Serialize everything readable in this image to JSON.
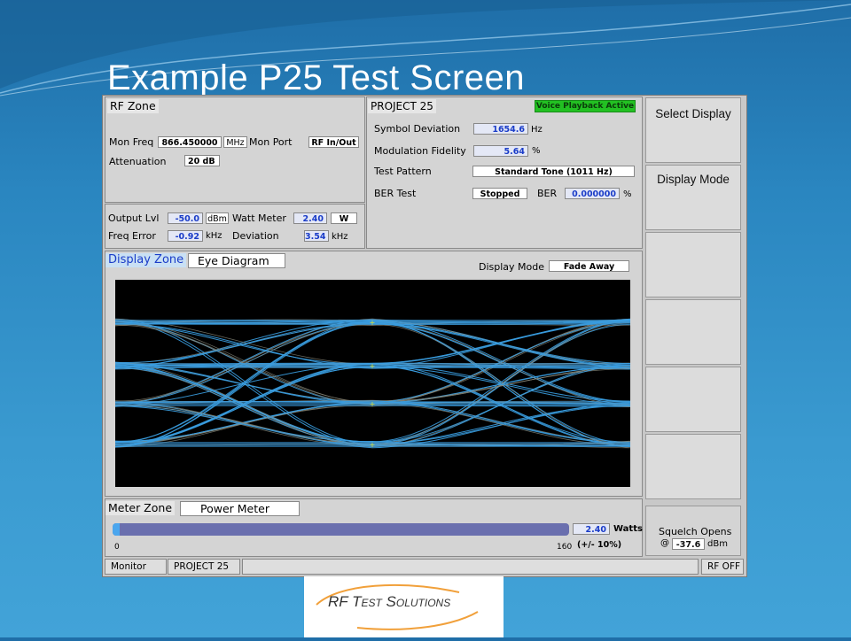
{
  "slide": {
    "title": "Example P25 Test Screen",
    "logo_text": "RF Test Solutions"
  },
  "rf_zone": {
    "title": "RF Zone",
    "mon_freq_label": "Mon Freq",
    "mon_freq_value": "866.450000",
    "mon_freq_unit": "MHz",
    "mon_port_label": "Mon Port",
    "mon_port_value": "RF In/Out",
    "attenuation_label": "Attenuation",
    "attenuation_value": "20 dB",
    "output_lvl_label": "Output Lvl",
    "output_lvl_value": "-50.0",
    "output_lvl_unit": "dBm",
    "watt_meter_label": "Watt Meter",
    "watt_meter_value": "2.40",
    "watt_meter_unit": "W",
    "freq_error_label": "Freq Error",
    "freq_error_value": "-0.92",
    "freq_error_unit": "kHz",
    "deviation_label": "Deviation",
    "deviation_value": "3.54",
    "deviation_unit": "kHz"
  },
  "project25": {
    "title": "PROJECT 25",
    "voice_badge": "Voice Playback Active",
    "symbol_dev_label": "Symbol Deviation",
    "symbol_dev_value": "1654.6",
    "symbol_dev_unit": "Hz",
    "mod_fidelity_label": "Modulation Fidelity",
    "mod_fidelity_value": "5.64",
    "mod_fidelity_unit": "%",
    "test_pattern_label": "Test Pattern",
    "test_pattern_value": "Standard Tone (1011 Hz)",
    "ber_test_label": "BER Test",
    "ber_test_value": "Stopped",
    "ber_label": "BER",
    "ber_value": "0.000000",
    "ber_unit": "%"
  },
  "display_zone": {
    "title": "Display Zone",
    "display_name": "Eye Diagram",
    "mode_label": "Display Mode",
    "mode_value": "Fade Away"
  },
  "meter_zone": {
    "title": "Meter Zone",
    "meter_name": "Power Meter",
    "scale_min": "0",
    "scale_max": "160",
    "reading": "2.40",
    "reading_unit": "Watts",
    "tolerance": "(+/- 10%)",
    "fill_fraction": 0.015
  },
  "softkeys": {
    "k1": "Select Display",
    "k2": "Display Mode",
    "k3": "",
    "k4": "",
    "k5": "",
    "k6": ""
  },
  "squelch": {
    "label": "Squelch Opens",
    "at": "@",
    "value": "-37.6",
    "unit": "dBm"
  },
  "status_bar": {
    "monitor": "Monitor",
    "project": "PROJECT 25",
    "rf": "RF OFF"
  },
  "colors": {
    "trace": "#3a9de0",
    "badge": "#22c022",
    "meter_fill": "#6a6fae"
  }
}
